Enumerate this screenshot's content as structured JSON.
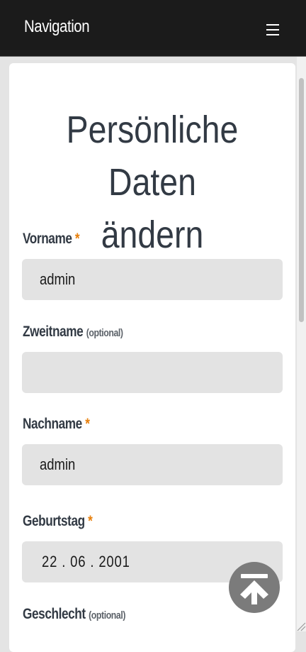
{
  "header": {
    "brand": "Navigation",
    "menu_icon": "hamburger-menu-icon"
  },
  "page": {
    "title_line1": "Persönliche Daten",
    "title_line2": "ändern"
  },
  "form": {
    "required_marker": "*",
    "optional_marker": "(optional)",
    "vorname": {
      "label": "Vorname",
      "value": "admin"
    },
    "zweitname": {
      "label": "Zweitname",
      "value": ""
    },
    "nachname": {
      "label": "Nachname",
      "value": "admin"
    },
    "geburtstag": {
      "label": "Geburtstag",
      "value": "22 . 06 . 2001"
    },
    "geschlecht": {
      "label": "Geschlecht"
    }
  },
  "scroll_to_top": {
    "icon": "arrow-to-top-icon"
  },
  "colors": {
    "topbar": "#1b1b1b",
    "required": "#e8800c",
    "field_bg": "#e3e3e3",
    "title": "#323a44"
  }
}
